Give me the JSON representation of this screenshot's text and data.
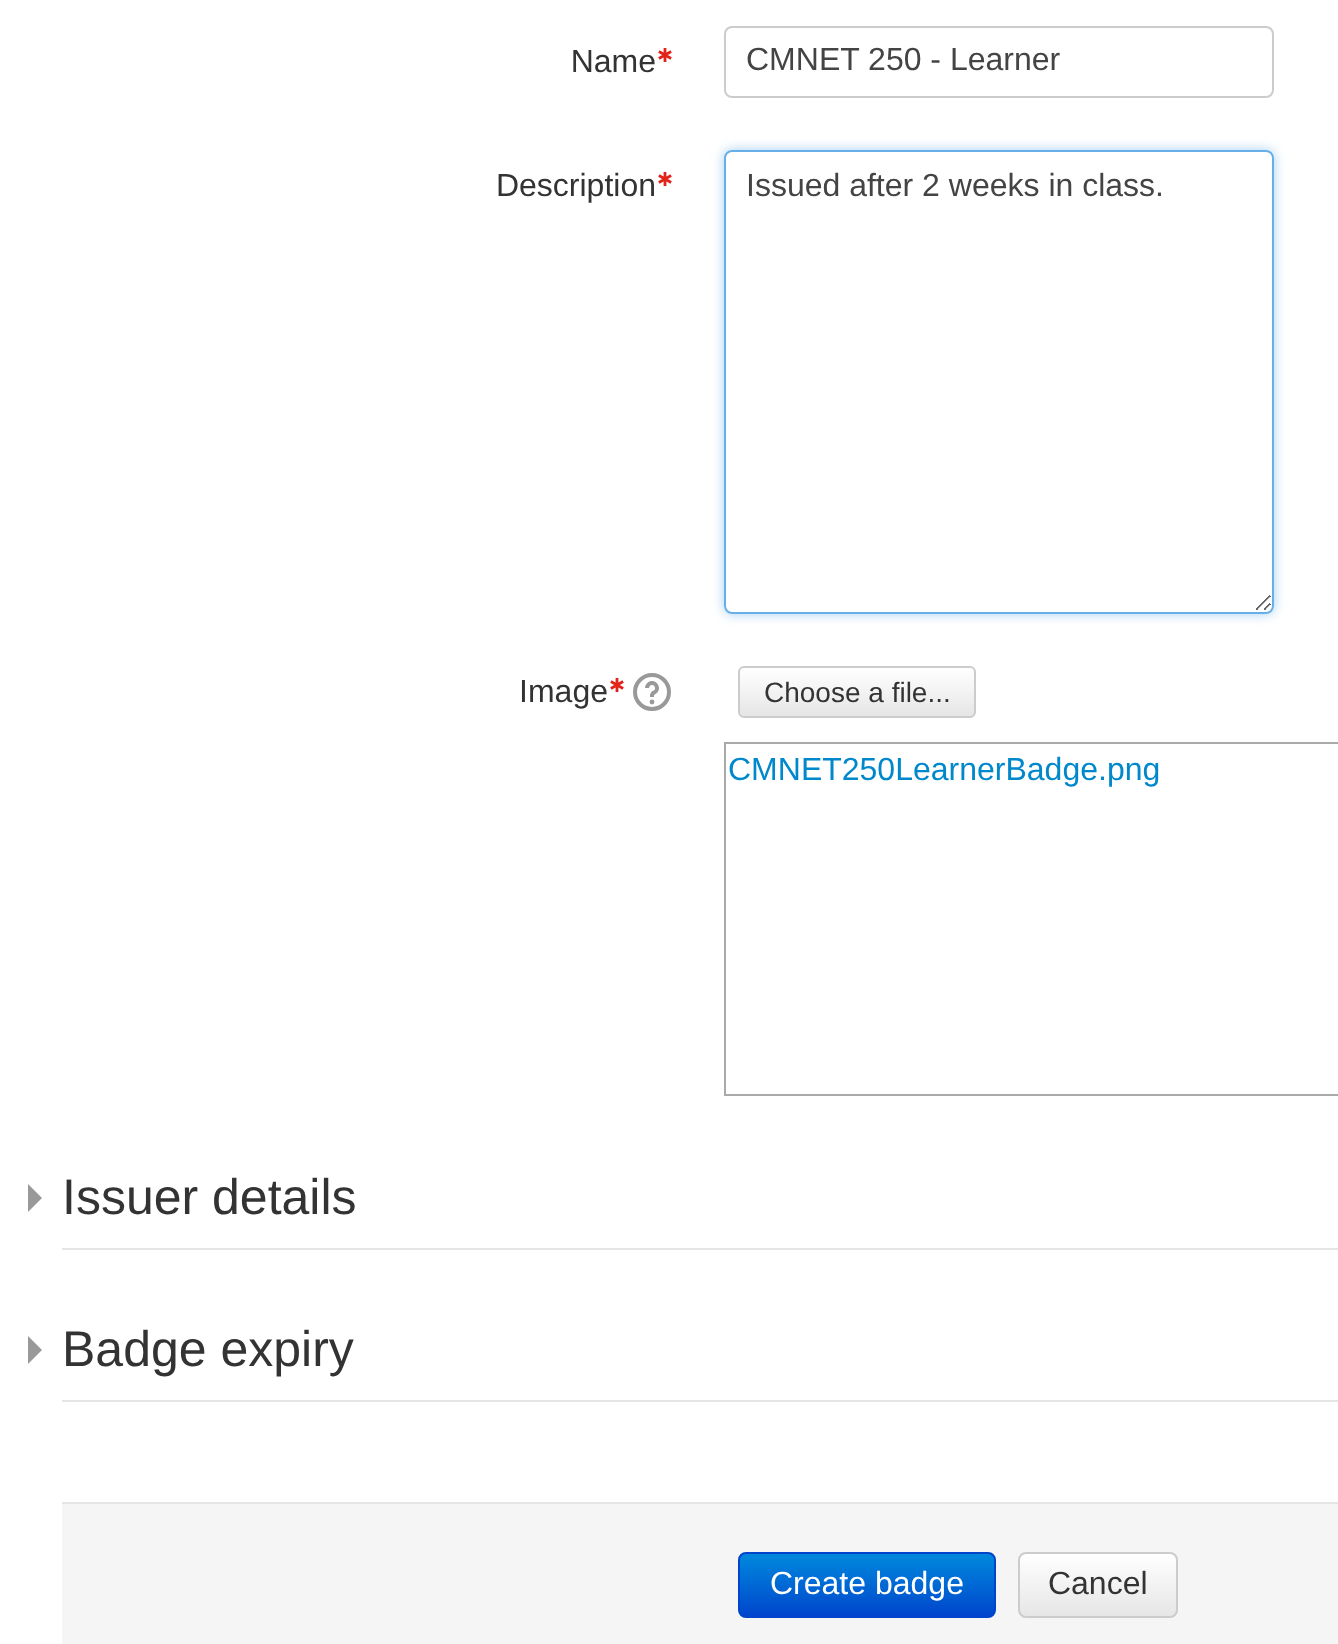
{
  "fields": [
    {
      "kind": "text",
      "label": "Name",
      "required": true,
      "help": false,
      "value": "CMNET 250 - Learner",
      "focused": false
    },
    {
      "kind": "textarea",
      "label": "Description",
      "required": true,
      "help": false,
      "value": "Issued after 2 weeks in class.",
      "focused": true
    },
    {
      "kind": "file",
      "label": "Image",
      "required": true,
      "help": true,
      "button": "Choose a file...",
      "file": "CMNET250LearnerBadge.png"
    }
  ],
  "sections": [
    {
      "title": "Issuer details",
      "expanded": false
    },
    {
      "title": "Badge expiry",
      "expanded": false
    }
  ],
  "buttons": [
    {
      "label": "Create badge",
      "kind": "primary"
    },
    {
      "label": "Cancel",
      "kind": "secondary"
    }
  ]
}
